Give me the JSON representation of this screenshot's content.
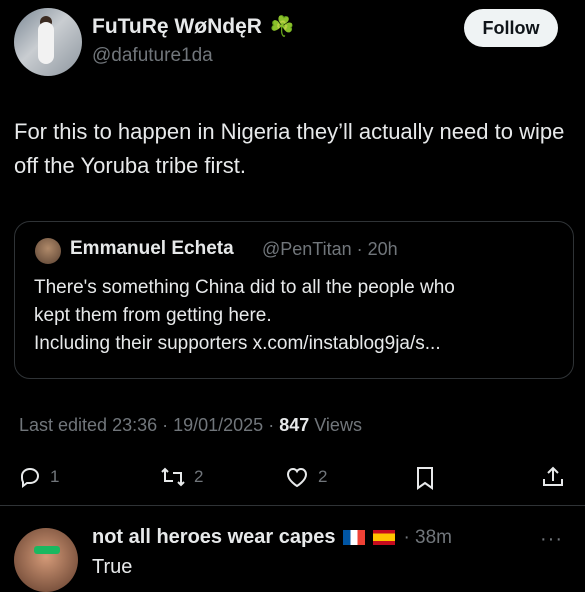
{
  "tweet": {
    "author_name": "FuTuRę WøNdęR",
    "author_emoji": "☘️",
    "handle": "@dafuture1da",
    "follow_label": "Follow",
    "text": "For this to happen in Nigeria they’ll actually need to wipe off the Yoruba tribe first.",
    "edited": "Last edited 23:36 · 19/01/2025 · ",
    "views_count": "847",
    "views_label": " Views",
    "actions": {
      "replies": "1",
      "reposts": "2",
      "likes": "2"
    }
  },
  "quote": {
    "name": "Emmanuel Echeta",
    "meta": "@PenTitan · 20h",
    "text_line1": "There's something China did to all the people who",
    "text_line2": "kept them from getting here.",
    "text_line3": "Including their supporters x.com/instablog9ja/s..."
  },
  "reply": {
    "name": "not all heroes wear capes",
    "time": "· 38m",
    "text": "True",
    "more": "···"
  }
}
